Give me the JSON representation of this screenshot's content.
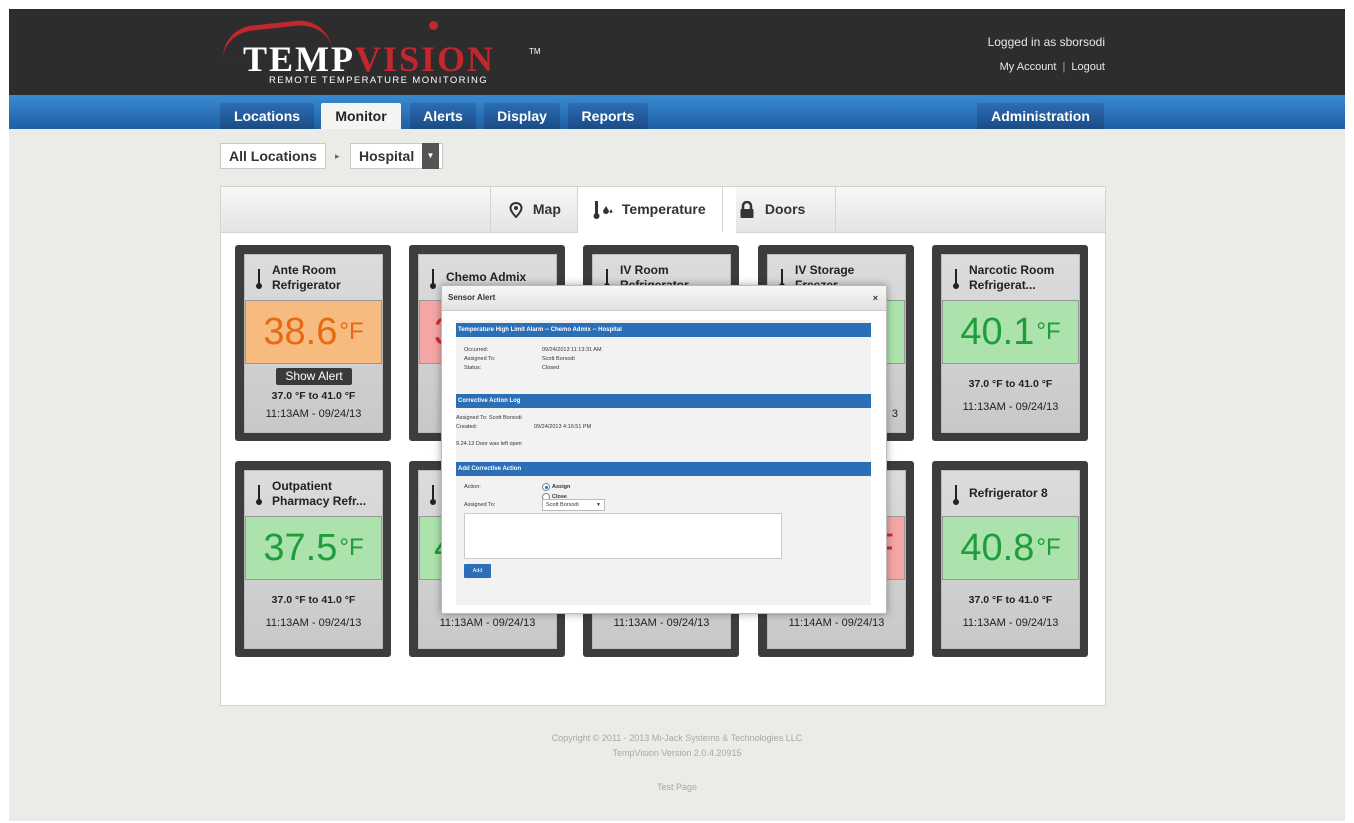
{
  "header": {
    "logo": {
      "word_pre": "TEMP",
      "word_v": "V",
      "word_post": "ISION",
      "tm": "TM",
      "tagline": "REMOTE TEMPERATURE MONITORING"
    },
    "user": {
      "logged_in": "Logged in as sborsodi",
      "my_account": "My Account",
      "separator": "|",
      "logout": "Logout"
    }
  },
  "nav": {
    "tabs": [
      "Locations",
      "Monitor",
      "Alerts",
      "Display",
      "Reports"
    ],
    "active": "Monitor",
    "admin": "Administration",
    "accent_color": "#1d5fa6"
  },
  "breadcrumb": {
    "root": "All Locations",
    "arrow": "▸",
    "current": "Hospital",
    "dropdown_icon": "▼"
  },
  "subtabs": [
    {
      "label": "Map",
      "icon": "map-pin-icon"
    },
    {
      "label": "Temperature",
      "icon": "thermometer-icon"
    },
    {
      "label": "Doors",
      "icon": "lock-icon"
    }
  ],
  "cards": [
    {
      "title_line1": "Ante Room",
      "title_line2": "Refrigerator",
      "temp": "38.6",
      "unit": "°F",
      "status": "orange",
      "alert_button": "Show Alert",
      "range": "37.0 °F to 41.0 °F",
      "time": "11:13AM - 09/24/13"
    },
    {
      "title_line1": "Chemo Admix",
      "title_line2": "",
      "temp": "3",
      "unit": "",
      "status": "red",
      "alert_button": "",
      "range": "",
      "time": ""
    },
    {
      "title_line1": "IV Room",
      "title_line2": "Refrigerator",
      "temp": "",
      "unit": "",
      "status": "hidden",
      "alert_button": "",
      "range": "",
      "time": ""
    },
    {
      "title_line1": "IV Storage",
      "title_line2": "Freezer",
      "temp": "",
      "unit": "",
      "status": "green",
      "alert_button": "",
      "range": "",
      "time": ""
    },
    {
      "title_line1": "Narcotic Room",
      "title_line2": "Refrigerat...",
      "temp": "40.1",
      "unit": "°F",
      "status": "green",
      "alert_button": "",
      "range": "37.0 °F to 41.0 °F",
      "time": "11:13AM - 09/24/13"
    },
    {
      "title_line1": "Outpatient",
      "title_line2": "Pharmacy Refr...",
      "temp": "37.5",
      "unit": "°F",
      "status": "green",
      "alert_button": "",
      "range": "37.0 °F to 41.0 °F",
      "time": "11:13AM - 09/24/13"
    },
    {
      "title_line1": "",
      "title_line2": "",
      "temp": "4",
      "unit": "",
      "status": "green",
      "alert_button": "",
      "range": "",
      "time": "11:13AM - 09/24/13"
    },
    {
      "title_line1": "",
      "title_line2": "",
      "temp": "",
      "unit": "",
      "status": "hidden",
      "alert_button": "",
      "range": "",
      "time": "11:13AM - 09/24/13"
    },
    {
      "title_line1": "",
      "title_line2": "",
      "temp": "F",
      "unit": "",
      "status": "red",
      "alert_button": "",
      "range": "",
      "time": "11:14AM - 09/24/13"
    },
    {
      "title_line1": "Refrigerator 8",
      "title_line2": "",
      "temp": "40.8",
      "unit": "°F",
      "status": "green",
      "alert_button": "",
      "range": "37.0 °F to 41.0 °F",
      "time": "11:13AM - 09/24/13"
    }
  ],
  "modal": {
    "title": "Sensor Alert",
    "close": "×",
    "alarm_heading": "Temperature High Limit Alarm -- Chemo Admix -- Hospital",
    "occurred_label": "Occurred:",
    "occurred_value": "09/24/2013 11:13:31 AM",
    "assigned_label": "Assigned To:",
    "assigned_value": "Scott Borsodi",
    "status_label": "Status:",
    "status_value": "Closed",
    "log_heading": "Corrective Action Log",
    "log_assigned": "Assigned To: Scott Borsodi",
    "log_created_label": "Created:",
    "log_created_value": "09/24/2013 4:16:51 PM",
    "log_note": "9.24.13 Door was left open",
    "add_heading": "Add Corrective Action",
    "action_label": "Action:",
    "assign_option": "Assign",
    "close_option": "Close",
    "assign_to_label": "Assigned To:",
    "assign_to_value": "Scott Borsodi",
    "add_button": "Add"
  },
  "footer": {
    "copyright": "Copyright © 2011 - 2013 Mi-Jack Systems & Technologies LLC",
    "version": "TempVision Version 2.0.4.20915",
    "test_page": "Test Page"
  }
}
